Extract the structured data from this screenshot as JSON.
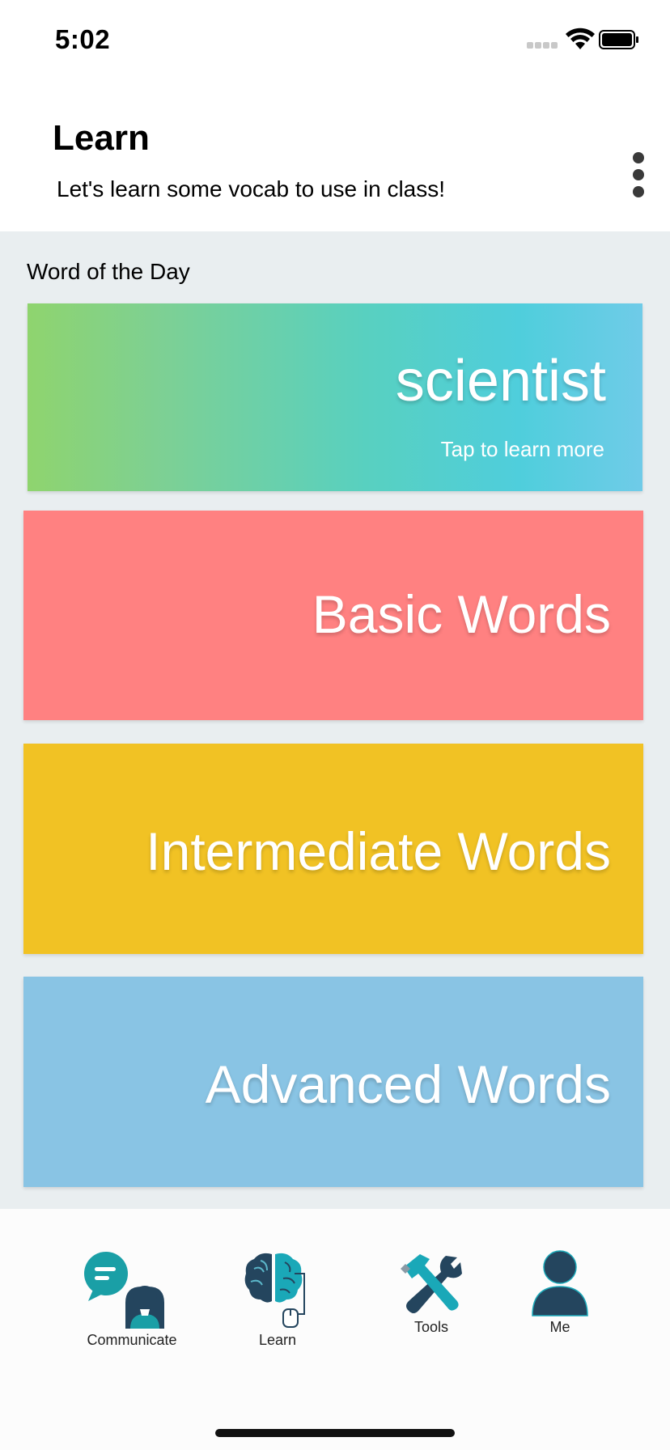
{
  "status_bar": {
    "time": "5:02"
  },
  "header": {
    "title": "Learn",
    "subtitle": "Let's learn some vocab to use in class!"
  },
  "word_of_the_day": {
    "section_label": "Word of the Day",
    "word": "scientist",
    "hint": "Tap to learn more"
  },
  "categories": [
    {
      "label": "Basic Words",
      "color": "#ff8181"
    },
    {
      "label": "Intermediate Words",
      "color": "#f1c224"
    },
    {
      "label": "Advanced Words",
      "color": "#89c4e4"
    }
  ],
  "tab_bar": {
    "items": [
      {
        "label": "Communicate",
        "icon": "communicate-icon"
      },
      {
        "label": "Learn",
        "icon": "brain-icon"
      },
      {
        "label": "Tools",
        "icon": "tools-icon"
      },
      {
        "label": "Me",
        "icon": "person-icon"
      }
    ]
  },
  "colors": {
    "teal": "#1a9fa6",
    "navy": "#24455e",
    "background": "#e9eef0"
  }
}
